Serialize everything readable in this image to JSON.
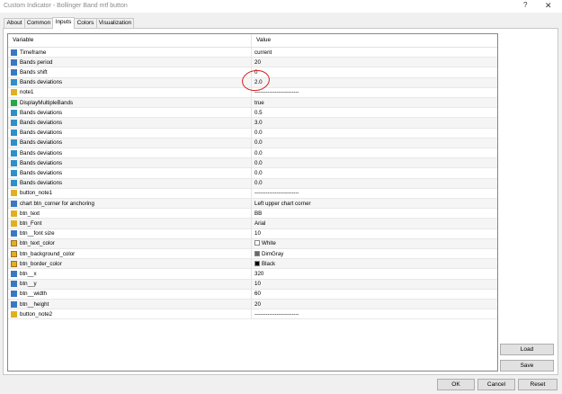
{
  "window": {
    "title": "Custom Indicator - Bollinger Band mtf button",
    "help": "?",
    "close": "✕"
  },
  "tabs": [
    {
      "label": "About"
    },
    {
      "label": "Common"
    },
    {
      "label": "Inputs"
    },
    {
      "label": "Colors"
    },
    {
      "label": "Visualization"
    }
  ],
  "grid": {
    "headers": {
      "variable": "Variable",
      "value": "Value"
    },
    "rows": [
      {
        "icon": "int",
        "name": "Timeframe",
        "value": "current"
      },
      {
        "icon": "int",
        "name": "Bands period",
        "value": "20"
      },
      {
        "icon": "int",
        "name": "Bands shift",
        "value": "0"
      },
      {
        "icon": "dbl",
        "name": "Bands deviations",
        "value": "2.0"
      },
      {
        "icon": "str",
        "name": "note1",
        "value": "------------------------"
      },
      {
        "icon": "bool",
        "name": "DisplayMultipleBands",
        "value": "true"
      },
      {
        "icon": "dbl",
        "name": "Bands deviations",
        "value": "0.5"
      },
      {
        "icon": "dbl",
        "name": "Bands deviations",
        "value": "3.0"
      },
      {
        "icon": "dbl",
        "name": "Bands deviations",
        "value": "0.0"
      },
      {
        "icon": "dbl",
        "name": "Bands deviations",
        "value": "0.0"
      },
      {
        "icon": "dbl",
        "name": "Bands deviations",
        "value": "0.0"
      },
      {
        "icon": "dbl",
        "name": "Bands deviations",
        "value": "0.0"
      },
      {
        "icon": "dbl",
        "name": "Bands deviations",
        "value": "0.0"
      },
      {
        "icon": "dbl",
        "name": "Bands deviations",
        "value": "0.0"
      },
      {
        "icon": "str",
        "name": "button_note1",
        "value": "------------------------"
      },
      {
        "icon": "int",
        "name": "chart btn_corner for anchoring",
        "value": "Left upper chart corner"
      },
      {
        "icon": "str",
        "name": "btn_text",
        "value": "BB"
      },
      {
        "icon": "str",
        "name": "btn_Font",
        "value": "Arial"
      },
      {
        "icon": "int",
        "name": "btn__font size",
        "value": "10"
      },
      {
        "icon": "col",
        "name": "btn_text_color",
        "value": "White",
        "swatch": "#ffffff"
      },
      {
        "icon": "col",
        "name": "btn_background_color",
        "value": "DimGray",
        "swatch": "#696969"
      },
      {
        "icon": "col",
        "name": "btn_border_color",
        "value": "Black",
        "swatch": "#000000"
      },
      {
        "icon": "int",
        "name": "btn__x",
        "value": "320"
      },
      {
        "icon": "int",
        "name": "btn__y",
        "value": "10"
      },
      {
        "icon": "int",
        "name": "btn__width",
        "value": "60"
      },
      {
        "icon": "int",
        "name": "btn__height",
        "value": "20"
      },
      {
        "icon": "str",
        "name": "button_note2",
        "value": "------------------------"
      }
    ]
  },
  "buttons": {
    "load": "Load",
    "save": "Save",
    "ok": "OK",
    "cancel": "Cancel",
    "reset": "Reset"
  },
  "annotation": {
    "color": "#d62020"
  }
}
